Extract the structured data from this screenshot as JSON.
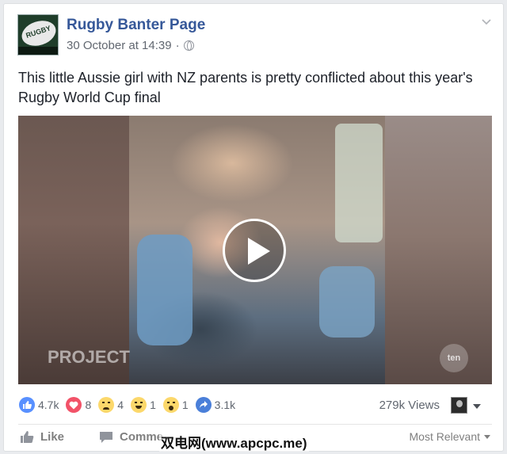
{
  "post": {
    "page_name": "Rugby Banter Page",
    "timestamp": "30 October at 14:39",
    "separator": "·",
    "privacy_icon": "globe-icon",
    "options_icon": "chevron-down-icon",
    "caption": "This little Aussie girl with NZ parents is pretty conflicted about this year's Rugby World Cup final",
    "avatar_text": "RUGBY"
  },
  "video": {
    "play_icon": "play-icon",
    "watermark_left": "PROJECT",
    "watermark_right": "ten"
  },
  "reactions": {
    "like": "4.7k",
    "love": "8",
    "sad": "4",
    "haha": "1",
    "wow": "1",
    "shares": "3.1k",
    "views": "279k Views"
  },
  "actions": {
    "like_label": "Like",
    "comment_label": "Comme",
    "sort_label": "Most Relevant"
  },
  "overlay": {
    "site_watermark": "双电网(www.apcpc.me)"
  },
  "colors": {
    "link_blue": "#365899",
    "like_blue": "#5890ff",
    "love_red": "#f25268",
    "emoji_yellow": "#fcd86b"
  }
}
